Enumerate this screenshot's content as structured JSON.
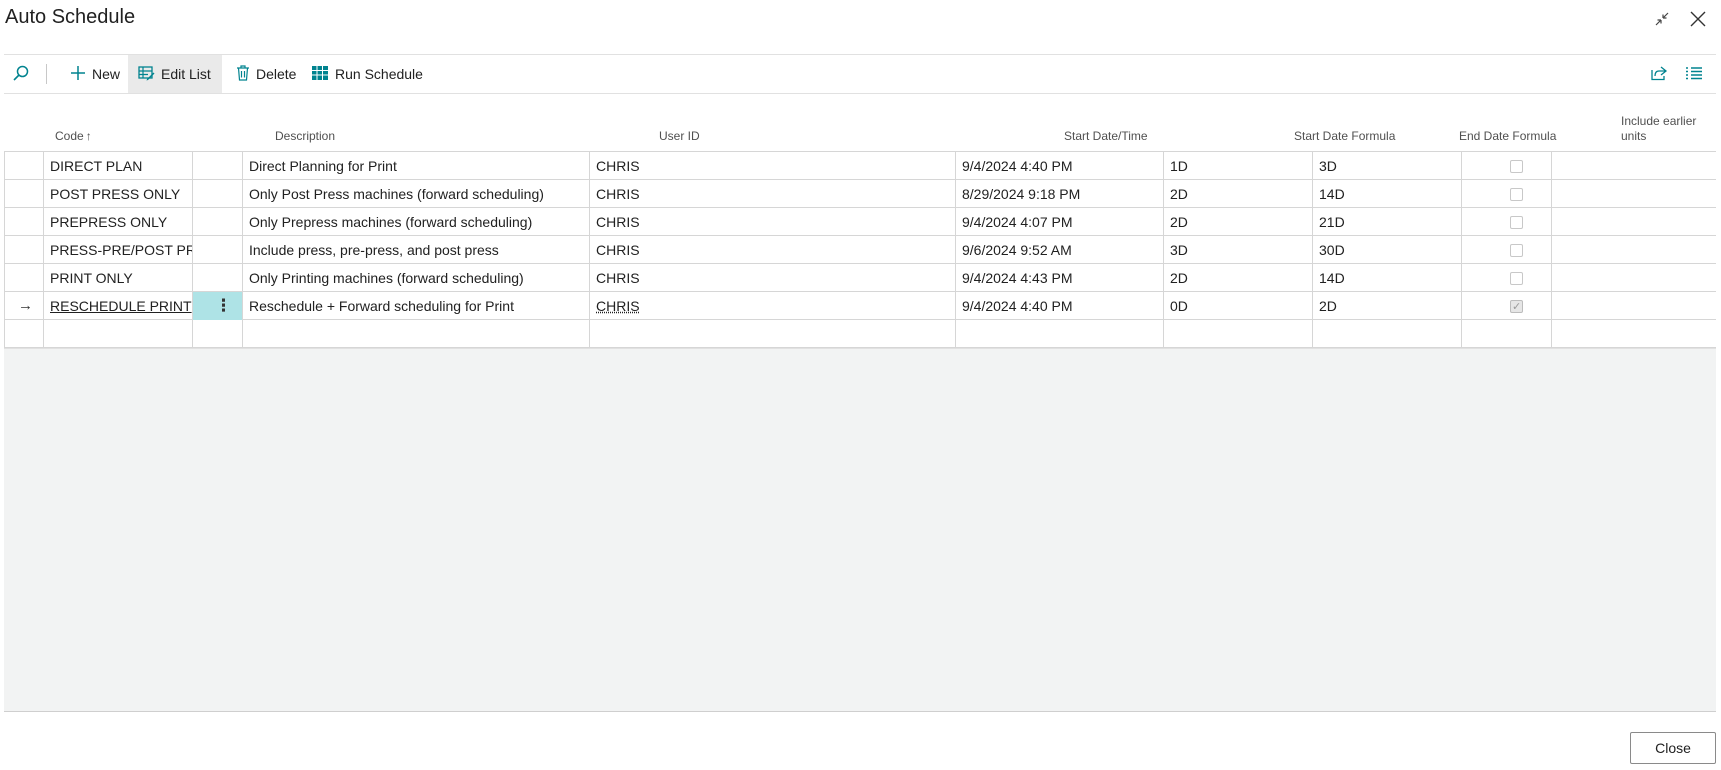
{
  "window": {
    "title": "Auto Schedule",
    "minimize_icon": "collapse-arrows-icon",
    "close_icon": "close-icon"
  },
  "toolbar": {
    "search_icon": "search-icon",
    "new_label": "New",
    "edit_list_label": "Edit List",
    "delete_label": "Delete",
    "run_schedule_label": "Run Schedule",
    "share_icon": "share-icon",
    "list_view_icon": "list-view-icon"
  },
  "table": {
    "columns": {
      "code": "Code",
      "sort_indicator": "↑",
      "description": "Description",
      "user_id": "User ID",
      "start_datetime": "Start Date/Time",
      "start_formula": "Start Date Formula",
      "end_formula": "End Date Formula",
      "include_earlier": "Include earlier units"
    },
    "rows": [
      {
        "code": "DIRECT PLAN",
        "description": "Direct Planning for Print",
        "user_id": "CHRIS",
        "start_datetime": "9/4/2024 4:40 PM",
        "start_formula": "1D",
        "end_formula": "3D",
        "include_earlier": false
      },
      {
        "code": "POST PRESS ONLY",
        "description": "Only Post Press machines (forward scheduling)",
        "user_id": "CHRIS",
        "start_datetime": "8/29/2024 9:18 PM",
        "start_formula": "2D",
        "end_formula": "14D",
        "include_earlier": false
      },
      {
        "code": "PREPRESS ONLY",
        "description": "Only Prepress machines (forward scheduling)",
        "user_id": "CHRIS",
        "start_datetime": "9/4/2024 4:07 PM",
        "start_formula": "2D",
        "end_formula": "21D",
        "include_earlier": false
      },
      {
        "code": "PRESS-PRE/POST PRESS",
        "description": "Include press, pre-press, and post press",
        "user_id": "CHRIS",
        "start_datetime": "9/6/2024 9:52 AM",
        "start_formula": "3D",
        "end_formula": "30D",
        "include_earlier": false
      },
      {
        "code": "PRINT ONLY",
        "description": "Only Printing machines (forward scheduling)",
        "user_id": "CHRIS",
        "start_datetime": "9/4/2024 4:43 PM",
        "start_formula": "2D",
        "end_formula": "14D",
        "include_earlier": false
      },
      {
        "code": "RESCHEDULE PRINT",
        "description": "Reschedule + Forward scheduling for Print",
        "user_id": "CHRIS",
        "start_datetime": "9/4/2024 4:40 PM",
        "start_formula": "0D",
        "end_formula": "2D",
        "include_earlier": true
      }
    ],
    "current_row_indicator": "→",
    "row_menu_glyph": "⋮"
  },
  "footer": {
    "close_label": "Close"
  },
  "colors": {
    "accent": "#00838f",
    "selected_cell": "#aee3e6",
    "empty_area": "#f2f3f3"
  }
}
